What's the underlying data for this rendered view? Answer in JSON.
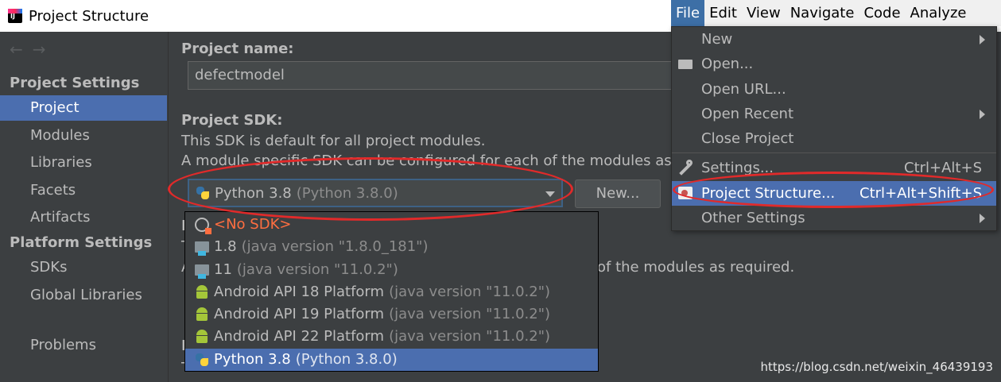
{
  "window": {
    "title": "Project Structure"
  },
  "sidebar": {
    "groups": [
      {
        "title": "Project Settings",
        "items": [
          "Project",
          "Modules",
          "Libraries",
          "Facets",
          "Artifacts"
        ]
      },
      {
        "title": "Platform Settings",
        "items": [
          "SDKs",
          "Global Libraries"
        ]
      }
    ],
    "problems": "Problems",
    "selected": "Project"
  },
  "main": {
    "project_name_label": "Project name:",
    "project_name_value": "defectmodel",
    "sdk_label": "Project SDK:",
    "sdk_desc_1": "This SDK is default for all project modules.",
    "sdk_desc_2": "A module specific SDK can be configured for each of the modules as req",
    "sdk_selected_name": "Python 3.8",
    "sdk_selected_detail": "(Python 3.8.0)",
    "new_button": "New...",
    "partial_line_1": "P",
    "partial_line_2": "T",
    "partial_line_3_start": "A",
    "partial_line_3_end": "of the modules as required.",
    "partial_line_4": "I",
    "partial_line_5": "This path is used to store all project compilation results."
  },
  "sdk_dropdown": {
    "items": [
      {
        "name": "<No SDK>",
        "detail": "",
        "icon": "no-sdk-icon"
      },
      {
        "name": "1.8",
        "detail": "(java version \"1.8.0_181\")",
        "icon": "jdk-folder-icon"
      },
      {
        "name": "11",
        "detail": "(java version \"11.0.2\")",
        "icon": "jdk-folder-icon"
      },
      {
        "name": "Android API 18 Platform",
        "detail": "(java version \"11.0.2\")",
        "icon": "android-icon"
      },
      {
        "name": "Android API 19 Platform",
        "detail": "(java version \"11.0.2\")",
        "icon": "android-icon"
      },
      {
        "name": "Android API 22 Platform",
        "detail": "(java version \"11.0.2\")",
        "icon": "android-icon"
      },
      {
        "name": "Python 3.8",
        "detail": "(Python 3.8.0)",
        "icon": "python-icon"
      }
    ],
    "selected": "Python 3.8"
  },
  "menubar": {
    "items": [
      "File",
      "Edit",
      "View",
      "Navigate",
      "Code",
      "Analyze"
    ],
    "active": "File"
  },
  "file_menu": {
    "items": [
      {
        "label": "New",
        "shortcut": "",
        "submenu": true
      },
      {
        "label": "Open...",
        "shortcut": "",
        "submenu": false
      },
      {
        "label": "Open URL...",
        "shortcut": "",
        "submenu": false
      },
      {
        "label": "Open Recent",
        "shortcut": "",
        "submenu": true
      },
      {
        "label": "Close Project",
        "shortcut": "",
        "submenu": false
      },
      {
        "label": "Settings...",
        "shortcut": "Ctrl+Alt+S",
        "submenu": false
      },
      {
        "label": "Project Structure...",
        "shortcut": "Ctrl+Alt+Shift+S",
        "submenu": false
      },
      {
        "label": "Other Settings",
        "shortcut": "",
        "submenu": true
      }
    ],
    "selected": "Project Structure..."
  },
  "watermark": "https://blog.csdn.net/weixin_46439193",
  "colors": {
    "selection": "#4b6eaf",
    "background": "#3c3f41",
    "annotation": "#e12a2a",
    "no_sdk": "#ff6e40"
  }
}
